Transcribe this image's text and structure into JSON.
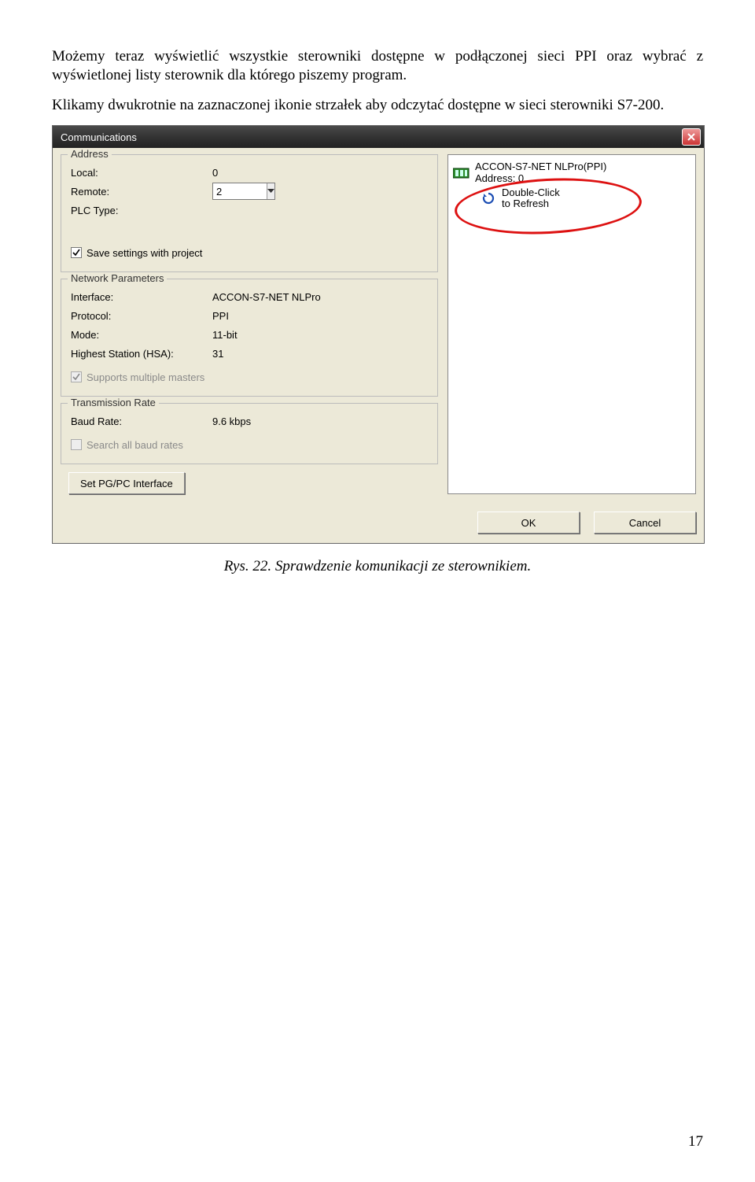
{
  "text": {
    "para1": "Możemy teraz wyświetlić wszystkie sterowniki dostępne w podłączonej sieci PPI oraz wybrać z wyświetlonej listy sterownik dla którego piszemy program.",
    "para2": "Klikamy dwukrotnie na zaznaczonej ikonie strzałek aby odczytać dostępne w sieci sterowniki S7-200.",
    "caption": "Rys. 22. Sprawdzenie komunikacji ze sterownikiem.",
    "page_no": "17"
  },
  "dialog": {
    "title": "Communications",
    "address": {
      "group_title": "Address",
      "local_label": "Local:",
      "local_value": "0",
      "remote_label": "Remote:",
      "remote_value": "2",
      "plc_type_label": "PLC Type:",
      "save_settings_label": "Save settings with project"
    },
    "network": {
      "group_title": "Network Parameters",
      "interface_label": "Interface:",
      "interface_value": "ACCON-S7-NET NLPro",
      "protocol_label": "Protocol:",
      "protocol_value": "PPI",
      "mode_label": "Mode:",
      "mode_value": "11-bit",
      "hsa_label": "Highest Station (HSA):",
      "hsa_value": "31",
      "supports_label": "Supports multiple masters"
    },
    "transmission": {
      "group_title": "Transmission Rate",
      "baud_label": "Baud Rate:",
      "baud_value": "9.6 kbps",
      "search_label": "Search all baud rates"
    },
    "pg_pc_label": "Set PG/PC Interface",
    "ok_label": "OK",
    "cancel_label": "Cancel",
    "tree": {
      "root_line1": "ACCON-S7-NET NLPro(PPI)",
      "root_line2": "Address: 0",
      "refresh_line1": "Double-Click",
      "refresh_line2": "to Refresh"
    }
  }
}
